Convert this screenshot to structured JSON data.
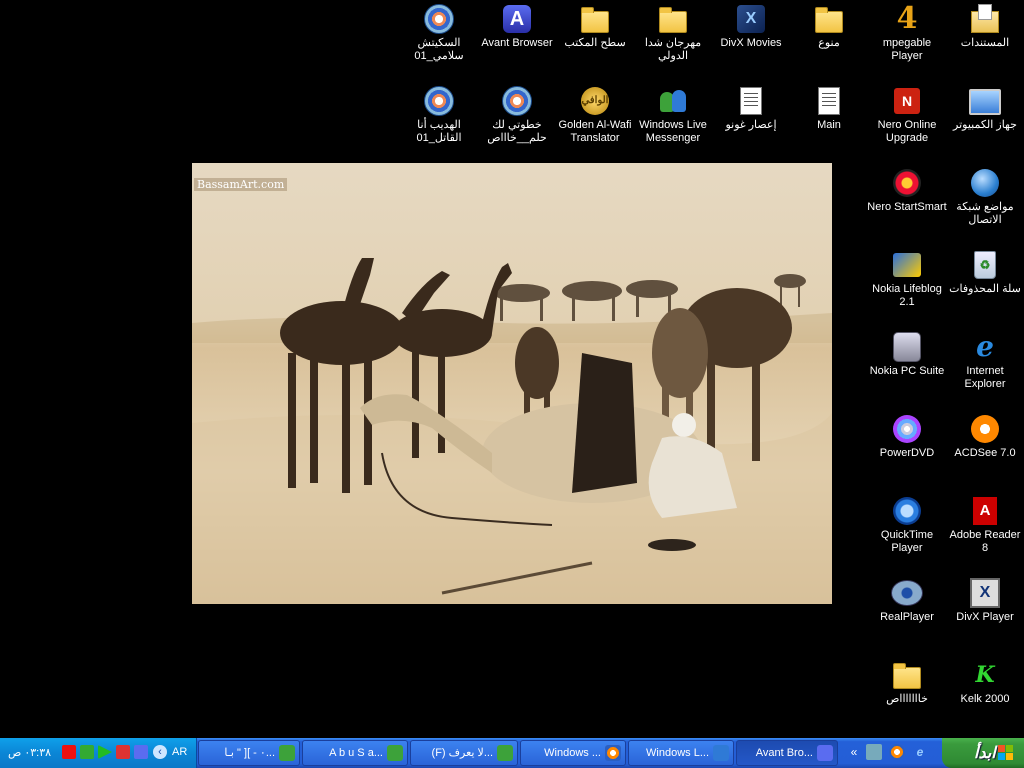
{
  "desktop": {
    "icons": [
      {
        "id": "my-documents",
        "label": "المستندات",
        "icon": "documents-folder-icon"
      },
      {
        "id": "mpegable",
        "label": "mpegable Player",
        "icon": "mpegable-icon"
      },
      {
        "id": "manwa",
        "label": "منوع",
        "icon": "folder-icon"
      },
      {
        "id": "divx-movies",
        "label": "DivX Movies",
        "icon": "divx-icon"
      },
      {
        "id": "festival",
        "label": "مهرجان شدا الدولي",
        "icon": "folder-icon"
      },
      {
        "id": "desktop-folder",
        "label": "سطح المكتب",
        "icon": "folder-icon"
      },
      {
        "id": "avant",
        "label": "Avant Browser",
        "icon": "avant-browser-icon"
      },
      {
        "id": "sketch",
        "label": "السكيتش سلامي_01",
        "icon": "media-file-icon"
      },
      {
        "id": "my-computer",
        "label": "جهاز الكمبيوتر",
        "icon": "computer-icon"
      },
      {
        "id": "nero-upgrade",
        "label": "Nero Online Upgrade",
        "icon": "nero-icon"
      },
      {
        "id": "main",
        "label": "Main",
        "icon": "document-icon"
      },
      {
        "id": "storm",
        "label": "إعصار غونو",
        "icon": "document-icon"
      },
      {
        "id": "wlm",
        "label": "Windows Live Messenger",
        "icon": "messenger-icon"
      },
      {
        "id": "alwafi",
        "label": "Golden Al-Wafi Translator",
        "icon": "translator-icon"
      },
      {
        "id": "step",
        "label": "خطوتي لك حلم__خاااص",
        "icon": "media-file-icon"
      },
      {
        "id": "hadeeb",
        "label": "الهديب أنا القاتل_01",
        "icon": "media-file-icon"
      },
      {
        "id": "network",
        "label": "مواضع شبكة الاتصال",
        "icon": "network-places-icon"
      },
      {
        "id": "nero-smart",
        "label": "Nero StartSmart",
        "icon": "nero-startsmart-icon"
      },
      {
        "id": "recycle",
        "label": "سلة المحذوفات",
        "icon": "recycle-bin-icon"
      },
      {
        "id": "lifeblog",
        "label": "Nokia Lifeblog 2.1",
        "icon": "lifeblog-icon"
      },
      {
        "id": "ie",
        "label": "Internet Explorer",
        "icon": "internet-explorer-icon"
      },
      {
        "id": "nokia-pc",
        "label": "Nokia PC Suite",
        "icon": "nokia-pc-suite-icon"
      },
      {
        "id": "acdsee",
        "label": "ACDSee 7.0",
        "icon": "acdsee-icon"
      },
      {
        "id": "powerdvd",
        "label": "PowerDVD",
        "icon": "powerdvd-icon"
      },
      {
        "id": "adobe",
        "label": "Adobe Reader 8",
        "icon": "adobe-reader-icon"
      },
      {
        "id": "quicktime",
        "label": "QuickTime Player",
        "icon": "quicktime-icon"
      },
      {
        "id": "divx-player",
        "label": "DivX Player",
        "icon": "divx-player-icon"
      },
      {
        "id": "realplayer",
        "label": "RealPlayer",
        "icon": "realplayer-icon"
      },
      {
        "id": "kelk",
        "label": "Kelk 2000",
        "icon": "kelk-icon"
      },
      {
        "id": "khaaa",
        "label": "خاااااااص",
        "icon": "folder-icon"
      }
    ],
    "icon_glyphs": {
      "divx": "X",
      "four": "4",
      "avant": "A",
      "nero": "N",
      "ie": "e",
      "pdf": "A",
      "divxp": "X",
      "kelk": "K",
      "gold": "الوافي",
      "bin": "♻"
    },
    "wallpaper": {
      "watermark": "BassamArt.com"
    }
  },
  "taskbar": {
    "start_label": "ابدأ",
    "quick_launch": [
      "ie-icon",
      "media-player-icon",
      "desktop-icon",
      "messenger-icon",
      "expand-arrow"
    ],
    "buttons": [
      {
        "label": "Avant Bro...",
        "icon": "avant-browser-icon",
        "active": true
      },
      {
        "label": "Windows L...",
        "icon": "messenger-icon",
        "active": false
      },
      {
        "label": "Windows ...",
        "icon": "media-player-icon",
        "active": false
      },
      {
        "label": "(F) لا يعرف...",
        "icon": "messenger-icon",
        "active": false
      },
      {
        "label": "A b u  S a...",
        "icon": "messenger-icon",
        "active": false
      },
      {
        "label": "٠ - ][ \" بـا...",
        "icon": "messenger-icon",
        "active": false
      }
    ],
    "tray": {
      "lang": "AR",
      "clock": "٠٣:٣٨ ص",
      "expand": "‹"
    }
  }
}
